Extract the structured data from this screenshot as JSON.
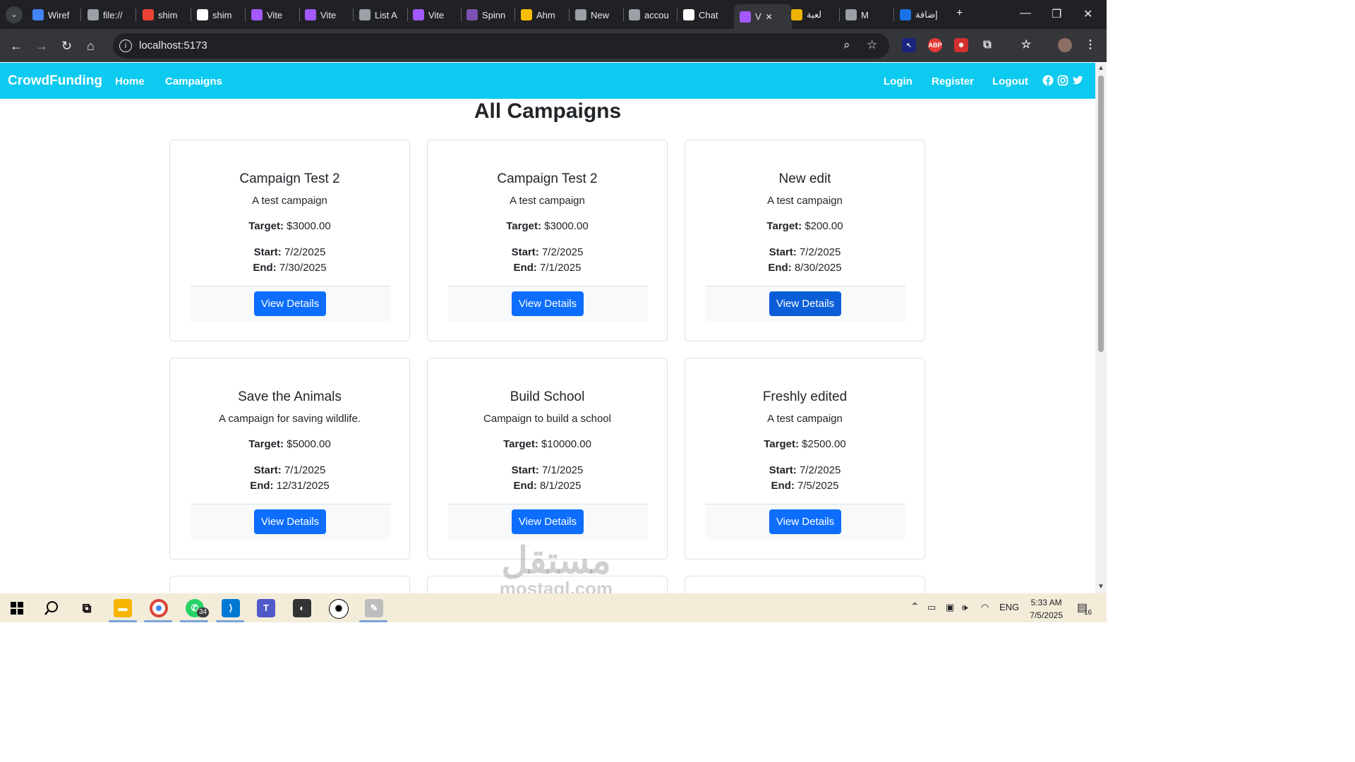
{
  "browser": {
    "tabs": [
      {
        "label": "Wiref",
        "icon": "wireframe-icon",
        "color": "#4285f4"
      },
      {
        "label": "file://",
        "icon": "globe-icon",
        "color": "#9aa0a6"
      },
      {
        "label": "shim",
        "icon": "gmail-icon",
        "color": "#ea4335"
      },
      {
        "label": "shim",
        "icon": "github-icon",
        "color": "#ffffff"
      },
      {
        "label": "Vite",
        "icon": "vite-icon",
        "color": "#a259ff"
      },
      {
        "label": "Vite",
        "icon": "vite-icon",
        "color": "#a259ff"
      },
      {
        "label": "List A",
        "icon": "globe-icon",
        "color": "#9aa0a6"
      },
      {
        "label": "Vite",
        "icon": "vite-icon",
        "color": "#a259ff"
      },
      {
        "label": "Spinn",
        "icon": "bootstrap-icon",
        "color": "#7952b3"
      },
      {
        "label": "Ahm",
        "icon": "drive-icon",
        "color": "#fbbc04"
      },
      {
        "label": "New",
        "icon": "chrome-icon",
        "color": "#9aa0a6"
      },
      {
        "label": "accou",
        "icon": "globe-icon",
        "color": "#9aa0a6"
      },
      {
        "label": "Chat",
        "icon": "chatgpt-icon",
        "color": "#ffffff"
      },
      {
        "label": "V",
        "icon": "vite-icon",
        "color": "#a259ff",
        "active": true
      },
      {
        "label": "لعبة",
        "icon": "game-icon",
        "color": "#f0b400"
      },
      {
        "label": "M",
        "icon": "globe-icon",
        "color": "#9aa0a6"
      },
      {
        "label": "إضافة",
        "icon": "circle-icon",
        "color": "#1a73e8"
      }
    ],
    "url": "localhost:5173"
  },
  "navbar": {
    "brand": "CrowdFunding",
    "links": [
      "Home",
      "Campaigns"
    ],
    "right_links": [
      "Login",
      "Register",
      "Logout"
    ]
  },
  "page": {
    "title": "All Campaigns",
    "target_label": "Target:",
    "start_label": "Start:",
    "end_label": "End:",
    "button_label": "View Details"
  },
  "campaigns": [
    {
      "title": "Campaign Test 2",
      "description": "A test campaign",
      "target": "$3000.00",
      "start": "7/2/2025",
      "end": "7/30/2025"
    },
    {
      "title": "Campaign Test 2",
      "description": "A test campaign",
      "target": "$3000.00",
      "start": "7/2/2025",
      "end": "7/1/2025"
    },
    {
      "title": "New edit",
      "description": "A test campaign",
      "target": "$200.00",
      "start": "7/2/2025",
      "end": "8/30/2025"
    },
    {
      "title": "Save the Animals",
      "description": "A campaign for saving wildlife.",
      "target": "$5000.00",
      "start": "7/1/2025",
      "end": "12/31/2025"
    },
    {
      "title": "Build School",
      "description": "Campaign to build a school",
      "target": "$10000.00",
      "start": "7/1/2025",
      "end": "8/1/2025"
    },
    {
      "title": "Freshly edited",
      "description": "A test campaign",
      "target": "$2500.00",
      "start": "7/2/2025",
      "end": "7/5/2025"
    }
  ],
  "watermark": {
    "arabic": "مستقل",
    "latin": "mostaql.com"
  },
  "taskbar": {
    "whatsapp_badge": "34",
    "language": "ENG",
    "time": "5:33 AM",
    "date": "7/5/2025",
    "notification_count": "16"
  }
}
